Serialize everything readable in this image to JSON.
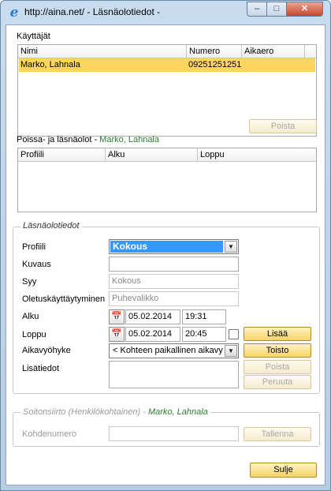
{
  "window": {
    "title": "http://aina.net/ - Läsnäolotiedot -",
    "min_label": "–",
    "max_label": "□",
    "close_label": "✕"
  },
  "users": {
    "section_label": "Käyttäjät",
    "columns": [
      "Nimi",
      "Numero",
      "Aikaero"
    ],
    "rows": [
      {
        "name": "Marko, Lahnala",
        "number": "09251251251",
        "offset": ""
      }
    ],
    "remove_label": "Poista"
  },
  "presence": {
    "label_prefix": "Poissa- ja läsnäolot -",
    "user_name": "Marko, Lahnala",
    "columns": [
      "Profiili",
      "Alku",
      "Loppu"
    ]
  },
  "details": {
    "legend": "Läsnäolotiedot",
    "profile_label": "Profiili",
    "profile_value": "Kokous",
    "description_label": "Kuvaus",
    "description_value": "",
    "reason_label": "Syy",
    "reason_value": "Kokous",
    "default_behavior_label": "Oletuskäyttäytyminen",
    "default_behavior_value": "Puhevalikko",
    "start_label": "Alku",
    "start_date": "05.02.2014",
    "start_time": "19:31",
    "end_label": "Loppu",
    "end_date": "05.02.2014",
    "end_time": "20:45",
    "timezone_label": "Aikavyöhyke",
    "timezone_value": "< Kohteen paikallinen aikavyö",
    "extra_label": "Lisätiedot",
    "add_label": "Lisää",
    "repeat_label": "Toisto",
    "delete_label": "Poista",
    "cancel_label": "Peruuta"
  },
  "forwarding": {
    "legend_prefix": "Soitonsiirto (Henkilökohtainen) -",
    "user_name": "Marko, Lahnala",
    "target_label": "Kohdenumero",
    "target_value": "",
    "save_label": "Tallenna"
  },
  "footer": {
    "close_label": "Sulje"
  },
  "icons": {
    "browser": "internet-explorer-icon",
    "calendar": "calendar-icon"
  }
}
